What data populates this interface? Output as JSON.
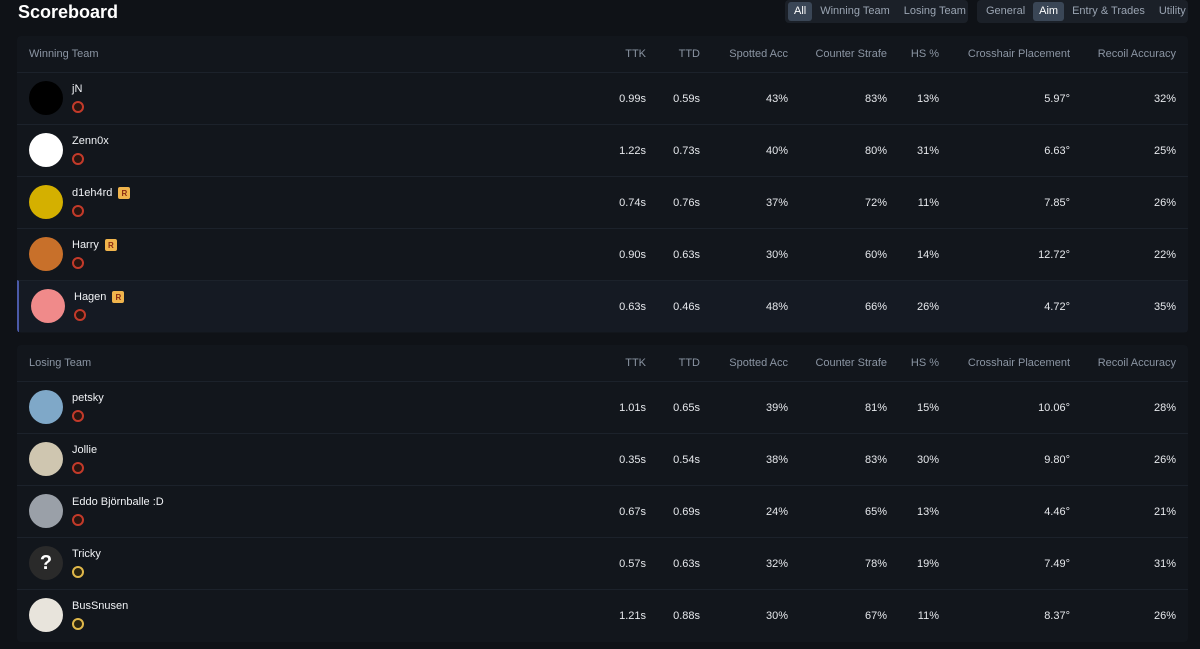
{
  "title": "Scoreboard",
  "team_filters": [
    {
      "label": "All",
      "active": true
    },
    {
      "label": "Winning Team",
      "active": false
    },
    {
      "label": "Losing Team",
      "active": false
    }
  ],
  "category_filters": [
    {
      "label": "General",
      "active": false
    },
    {
      "label": "Aim",
      "active": true
    },
    {
      "label": "Entry & Trades",
      "active": false
    },
    {
      "label": "Utility",
      "active": false
    }
  ],
  "columns": [
    "TTK",
    "TTD",
    "Spotted Acc",
    "Counter Strafe",
    "HS %",
    "Crosshair Placement",
    "Recoil Accuracy"
  ],
  "teams": [
    {
      "name": "Winning Team",
      "players": [
        {
          "name": "jN",
          "badge": false,
          "rank_color": "red",
          "avatar": "#000000",
          "stats": [
            "0.99s",
            "0.59s",
            "43%",
            "83%",
            "13%",
            "5.97°",
            "32%"
          ]
        },
        {
          "name": "Zenn0x",
          "badge": false,
          "rank_color": "red",
          "avatar": "#ffffff",
          "stats": [
            "1.22s",
            "0.73s",
            "40%",
            "80%",
            "31%",
            "6.63°",
            "25%"
          ]
        },
        {
          "name": "d1eh4rd",
          "badge": true,
          "rank_color": "red",
          "avatar": "#d4b000",
          "stats": [
            "0.74s",
            "0.76s",
            "37%",
            "72%",
            "11%",
            "7.85°",
            "26%"
          ]
        },
        {
          "name": "Harry",
          "badge": true,
          "rank_color": "red",
          "avatar": "#c8702a",
          "stats": [
            "0.90s",
            "0.63s",
            "30%",
            "60%",
            "14%",
            "12.72°",
            "22%"
          ]
        },
        {
          "name": "Hagen",
          "badge": true,
          "rank_color": "red",
          "avatar": "#f08a8a",
          "highlight": true,
          "stats": [
            "0.63s",
            "0.46s",
            "48%",
            "66%",
            "26%",
            "4.72°",
            "35%"
          ]
        }
      ]
    },
    {
      "name": "Losing Team",
      "players": [
        {
          "name": "petsky",
          "badge": false,
          "rank_color": "red",
          "avatar": "#7fa8c8",
          "stats": [
            "1.01s",
            "0.65s",
            "39%",
            "81%",
            "15%",
            "10.06°",
            "28%"
          ]
        },
        {
          "name": "Jollie",
          "badge": false,
          "rank_color": "red",
          "avatar": "#cfc6b0",
          "stats": [
            "0.35s",
            "0.54s",
            "38%",
            "83%",
            "30%",
            "9.80°",
            "26%"
          ]
        },
        {
          "name": "Eddo Björnballe :D",
          "badge": false,
          "rank_color": "red",
          "avatar": "#9aa0a8",
          "stats": [
            "0.67s",
            "0.69s",
            "24%",
            "65%",
            "13%",
            "4.46°",
            "21%"
          ]
        },
        {
          "name": "Tricky",
          "badge": false,
          "rank_color": "gold",
          "avatar": "#2a2a2a",
          "avatar_text": "?",
          "stats": [
            "0.57s",
            "0.63s",
            "32%",
            "78%",
            "19%",
            "7.49°",
            "31%"
          ]
        },
        {
          "name": "BusSnusen",
          "badge": false,
          "rank_color": "gold",
          "avatar": "#e8e4dc",
          "stats": [
            "1.21s",
            "0.88s",
            "30%",
            "67%",
            "11%",
            "8.37°",
            "26%"
          ]
        }
      ]
    }
  ]
}
